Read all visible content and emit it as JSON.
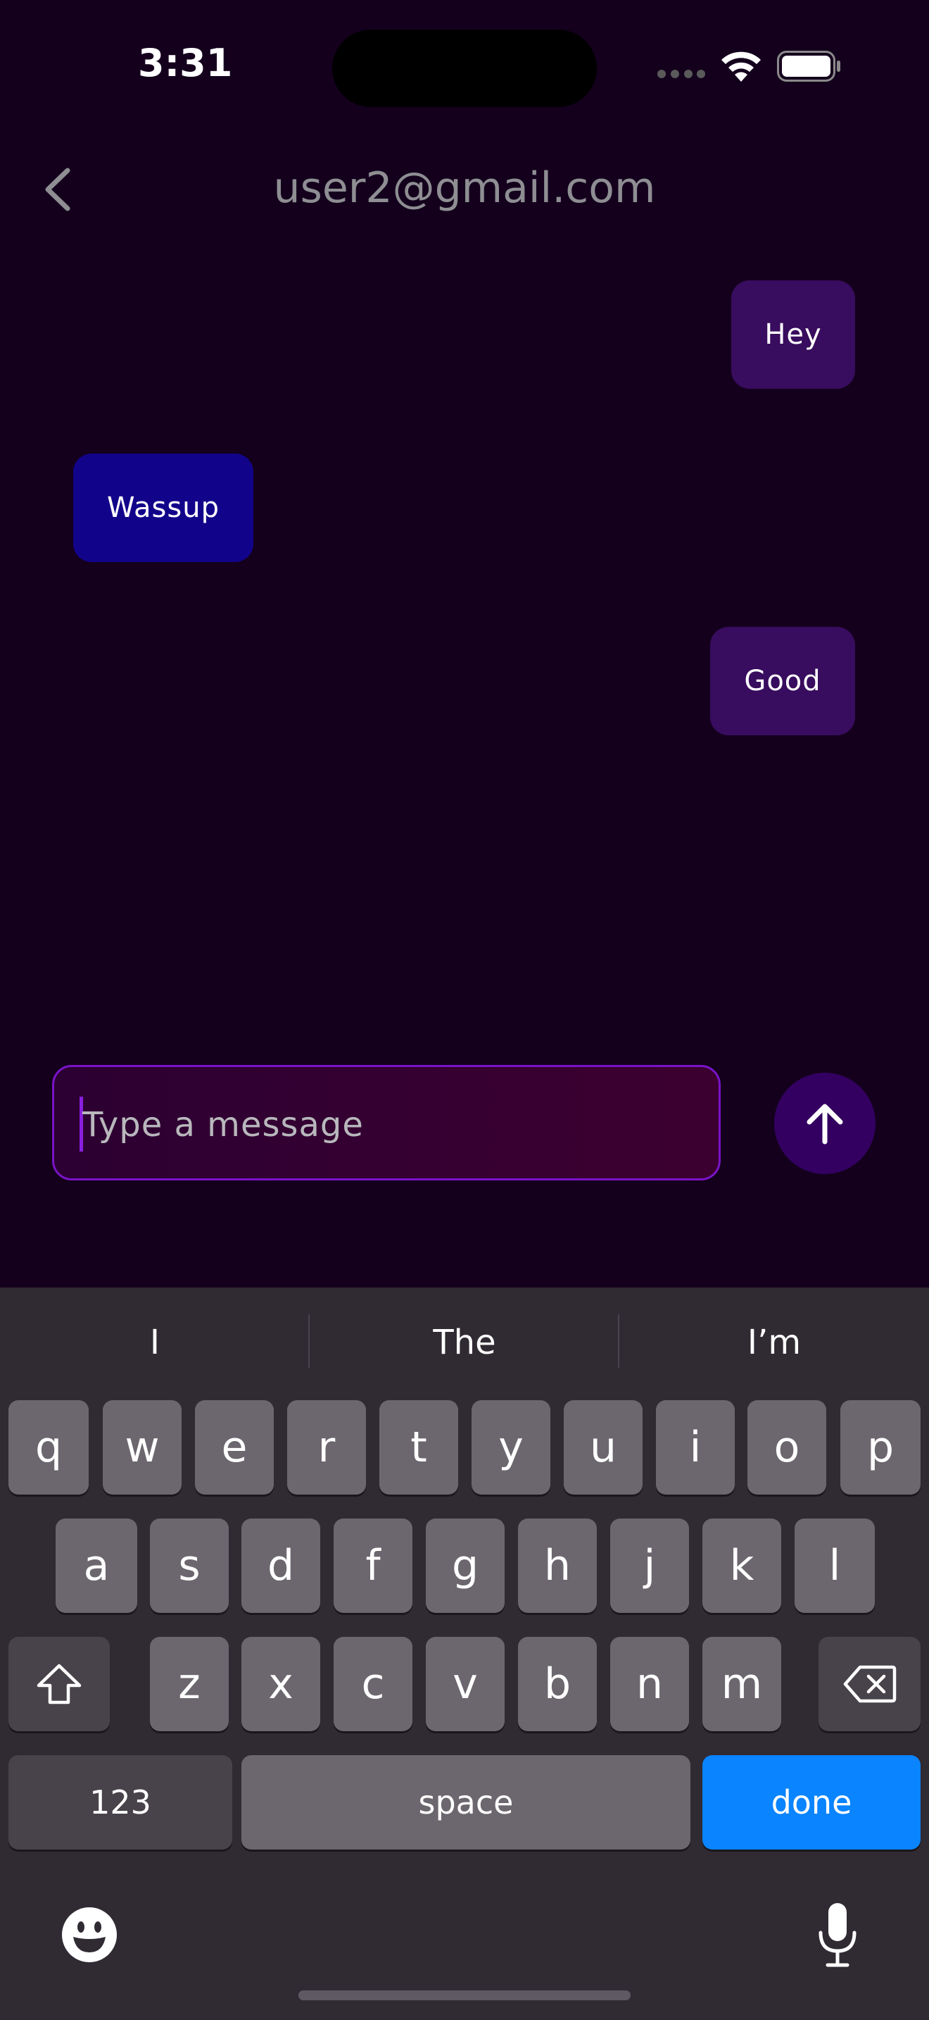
{
  "status_bar": {
    "time": "3:31"
  },
  "header": {
    "title": "user2@gmail.com"
  },
  "messages": [
    {
      "text": "Hey",
      "side": "sent"
    },
    {
      "text": "Wassup",
      "side": "received"
    },
    {
      "text": "Good",
      "side": "sent"
    }
  ],
  "composer": {
    "placeholder": "Type a message"
  },
  "keyboard": {
    "suggestions": [
      "I",
      "The",
      "I’m"
    ],
    "row1": [
      "q",
      "w",
      "e",
      "r",
      "t",
      "y",
      "u",
      "i",
      "o",
      "p"
    ],
    "row2": [
      "a",
      "s",
      "d",
      "f",
      "g",
      "h",
      "j",
      "k",
      "l"
    ],
    "row3": [
      "z",
      "x",
      "c",
      "v",
      "b",
      "n",
      "m"
    ],
    "numbers_label": "123",
    "space_label": "space",
    "done_label": "done"
  },
  "colors": {
    "background": "#14001d",
    "sent_bubble": "#380c5e",
    "received_bubble": "#12048a",
    "input_border": "#7a13c8",
    "send_button": "#330062",
    "done_key": "#0a84ff"
  }
}
